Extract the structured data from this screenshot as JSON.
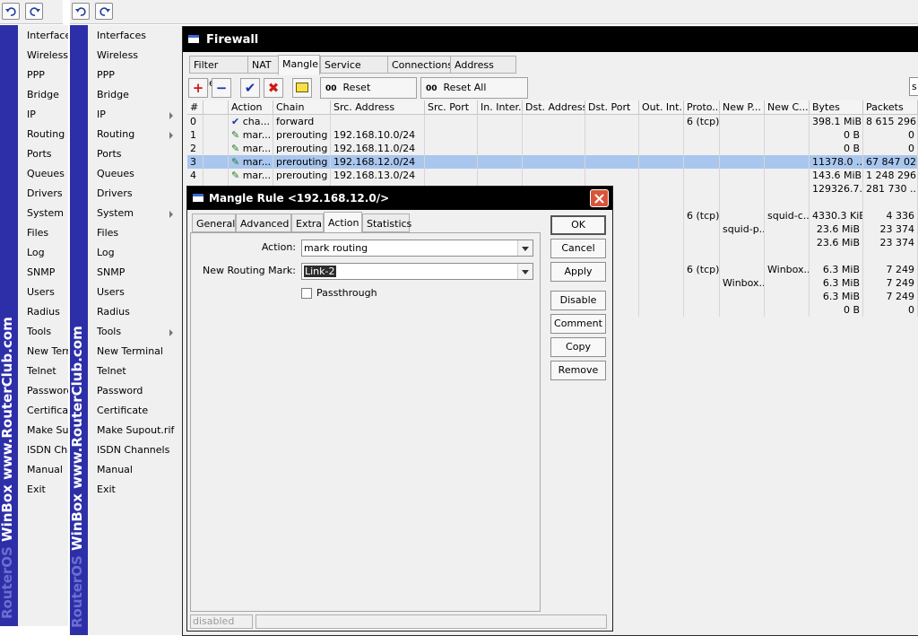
{
  "toolbar": {
    "undo_icon": "undo-icon",
    "redo_icon": "redo-icon"
  },
  "sidebar_brand": {
    "text_dim": "RouterOS ",
    "text_bright": "WinBox   www.RouterClub.com"
  },
  "menu_left": [
    "Interfaces",
    "Wireless",
    "PPP",
    "Bridge",
    "IP",
    "Routing",
    "Ports",
    "Queues",
    "Drivers",
    "System",
    "Files",
    "Log",
    "SNMP",
    "Users",
    "Radius",
    "Tools",
    "New Terminal",
    "Telnet",
    "Password",
    "Certificate",
    "Make Supout.rif",
    "ISDN Channels",
    "Manual",
    "Exit"
  ],
  "menu_right": [
    "Interfaces",
    "Wireless",
    "PPP",
    "Bridge",
    "IP",
    "Routing",
    "Ports",
    "Queues",
    "Drivers",
    "System",
    "Files",
    "Log",
    "SNMP",
    "Users",
    "Radius",
    "Tools",
    "New Terminal",
    "Telnet",
    "Password",
    "Certificate",
    "Make Supout.rif",
    "ISDN Channels",
    "Manual",
    "Exit"
  ],
  "submenu_items": [
    "IP",
    "Routing",
    "System",
    "Tools"
  ],
  "firewall": {
    "title": "Firewall",
    "tabs": [
      "Filter Rules",
      "NAT",
      "Mangle",
      "Service Ports",
      "Connections",
      "Address Lists"
    ],
    "active_tab": "Mangle",
    "reset_counters": "Reset Counters",
    "reset_all_counters": "Reset All Counters",
    "counter_prefix": "00",
    "search_fragment": "s",
    "columns": [
      "#",
      "",
      "Action",
      "Chain",
      "Src. Address",
      "Src. Port",
      "In. Inter...",
      "Dst. Address",
      "Dst. Port",
      "Out. Int...",
      "Proto...",
      "New P...",
      "New C...",
      "Bytes",
      "Packets"
    ],
    "rows": [
      {
        "num": "0",
        "action_icon": "check-icon",
        "action": "cha...",
        "chain": "forward",
        "src": "",
        "proto": "6 (tcp)",
        "newp": "",
        "newc": "",
        "bytes": "398.1 MiB",
        "packets": "8 615 296"
      },
      {
        "num": "1",
        "action_icon": "pencil-icon",
        "action": "mar...",
        "chain": "prerouting",
        "src": "192.168.10.0/24",
        "proto": "",
        "newp": "",
        "newc": "",
        "bytes": "0 B",
        "packets": "0"
      },
      {
        "num": "2",
        "action_icon": "pencil-icon",
        "action": "mar...",
        "chain": "prerouting",
        "src": "192.168.11.0/24",
        "proto": "",
        "newp": "",
        "newc": "",
        "bytes": "0 B",
        "packets": "0"
      },
      {
        "num": "3",
        "action_icon": "pencil-icon",
        "action": "mar...",
        "chain": "prerouting",
        "src": "192.168.12.0/24",
        "proto": "",
        "newp": "",
        "newc": "",
        "bytes": "11378.0 ...",
        "packets": "67 847 027",
        "selected": true
      },
      {
        "num": "4",
        "action_icon": "pencil-icon",
        "action": "mar...",
        "chain": "prerouting",
        "src": "192.168.13.0/24",
        "proto": "",
        "newp": "",
        "newc": "",
        "bytes": "143.6 MiB",
        "packets": "1 248 296"
      },
      {
        "num": "",
        "action_icon": "",
        "action": "",
        "chain": "",
        "src": "",
        "proto": "",
        "newp": "",
        "newc": "",
        "bytes": "129326.7...",
        "packets": "281 730 ..."
      },
      {
        "num": "",
        "action_icon": "",
        "action": "",
        "chain": "",
        "src": "",
        "proto": "",
        "newp": "",
        "newc": "",
        "bytes": "",
        "packets": ""
      },
      {
        "num": "",
        "action_icon": "",
        "action": "",
        "chain": "",
        "src": "",
        "proto": "6 (tcp)",
        "newp": "",
        "newc": "squid-c...",
        "bytes": "4330.3 KiB",
        "packets": "4 336"
      },
      {
        "num": "",
        "action_icon": "",
        "action": "",
        "chain": "",
        "src": "",
        "proto": "",
        "newp": "squid-p...",
        "newc": "",
        "bytes": "23.6 MiB",
        "packets": "23 374"
      },
      {
        "num": "",
        "action_icon": "",
        "action": "",
        "chain": "",
        "src": "",
        "proto": "",
        "newp": "",
        "newc": "",
        "bytes": "23.6 MiB",
        "packets": "23 374"
      },
      {
        "num": "",
        "action_icon": "",
        "action": "",
        "chain": "",
        "src": "",
        "proto": "",
        "newp": "",
        "newc": "",
        "bytes": "",
        "packets": ""
      },
      {
        "num": "",
        "action_icon": "",
        "action": "",
        "chain": "",
        "src": "",
        "proto": "6 (tcp)",
        "newp": "",
        "newc": "Winbox...",
        "bytes": "6.3 MiB",
        "packets": "7 249"
      },
      {
        "num": "",
        "action_icon": "",
        "action": "",
        "chain": "",
        "src": "",
        "proto": "",
        "newp": "Winbox...",
        "newc": "",
        "bytes": "6.3 MiB",
        "packets": "7 249"
      },
      {
        "num": "",
        "action_icon": "",
        "action": "",
        "chain": "",
        "src": "",
        "proto": "",
        "newp": "",
        "newc": "",
        "bytes": "6.3 MiB",
        "packets": "7 249"
      },
      {
        "num": "",
        "action_icon": "",
        "action": "",
        "chain": "",
        "src": "",
        "proto": "",
        "newp": "",
        "newc": "",
        "bytes": "0 B",
        "packets": "0"
      }
    ]
  },
  "dialog": {
    "title": "Mangle Rule <192.168.12.0/>",
    "tabs": [
      "General",
      "Advanced",
      "Extra",
      "Action",
      "Statistics"
    ],
    "active_tab": "Action",
    "action_label": "Action:",
    "action_value": "mark routing",
    "routing_mark_label": "New Routing Mark:",
    "routing_mark_value": "Link-2",
    "passthrough_label": "Passthrough",
    "passthrough_checked": false,
    "buttons": [
      "OK",
      "Cancel",
      "Apply",
      "Disable",
      "Comment",
      "Copy",
      "Remove"
    ],
    "status": "disabled"
  }
}
